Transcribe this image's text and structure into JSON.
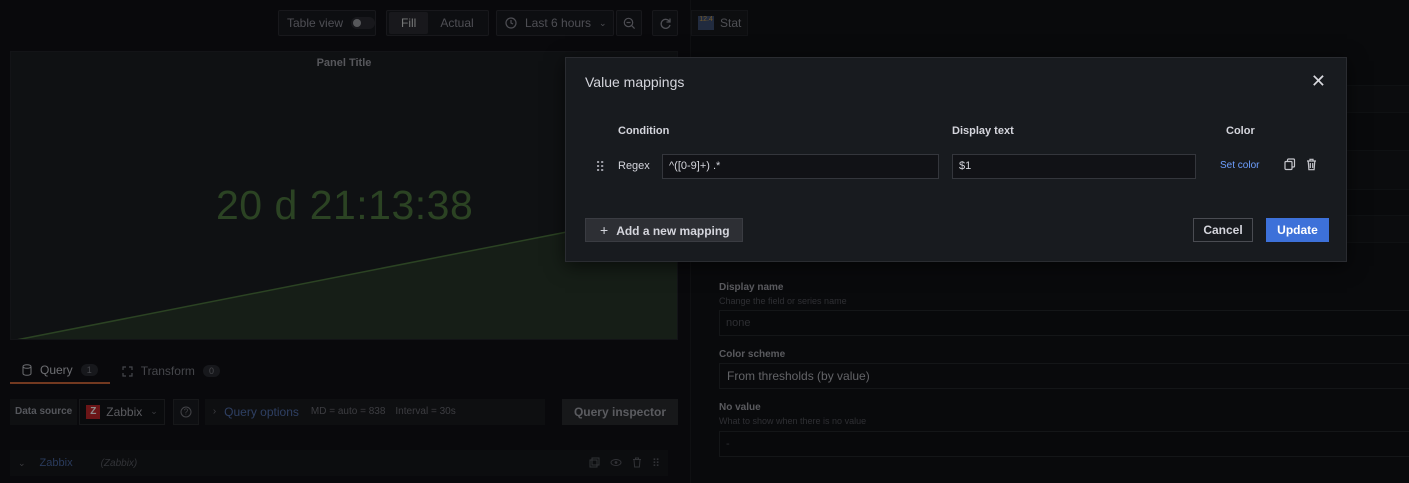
{
  "toolbar": {
    "table_view_label": "Table view",
    "fill_label": "Fill",
    "actual_label": "Actual",
    "time_range_label": "Last 6 hours"
  },
  "panel": {
    "title": "Panel Title",
    "stat_value": "20 d 21:13:38"
  },
  "query_tabs": {
    "query_label": "Query",
    "query_count": "1",
    "transform_label": "Transform",
    "transform_count": "0"
  },
  "query_row": {
    "datasource_label": "Data source",
    "datasource_value": "Zabbix",
    "query_options_label": "Query options",
    "md_text": "MD = auto = 838",
    "interval_text": "Interval = 30s",
    "inspector_label": "Query inspector"
  },
  "zabbix_row": {
    "name": "Zabbix",
    "sub": "(Zabbix)"
  },
  "right": {
    "viz_label": "Stat",
    "display_name_label": "Display name",
    "display_name_desc": "Change the field or series name",
    "display_name_placeholder": "none",
    "color_scheme_label": "Color scheme",
    "color_scheme_value": "From thresholds (by value)",
    "no_value_label": "No value",
    "no_value_desc": "What to show when there is no value",
    "no_value_placeholder": "-"
  },
  "modal": {
    "title": "Value mappings",
    "col_condition": "Condition",
    "col_display_text": "Display text",
    "col_color": "Color",
    "row": {
      "type": "Regex",
      "pattern": "^([0-9]+) .*",
      "display_text": "$1",
      "set_color_label": "Set color"
    },
    "add_label": "Add a new mapping",
    "cancel_label": "Cancel",
    "update_label": "Update"
  },
  "colors": {
    "accent_blue": "#3d71d9",
    "stat_green": "#4f7a40",
    "tab_underline": "#d2683b"
  }
}
